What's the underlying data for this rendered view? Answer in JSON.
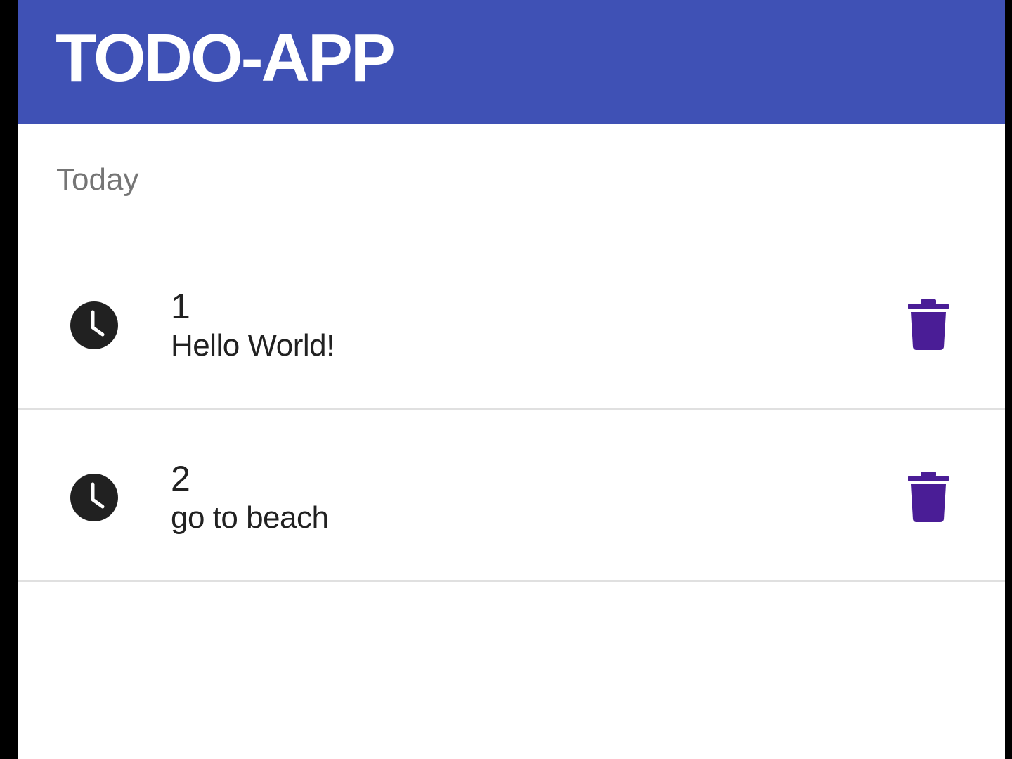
{
  "app": {
    "title": "TODO-APP",
    "header_color": "#3f51b5"
  },
  "list": {
    "subheader": "Today",
    "items": [
      {
        "id": "1",
        "text": "Hello World!",
        "icon": "clock-icon",
        "action_icon": "trash-icon"
      },
      {
        "id": "2",
        "text": "go to beach",
        "icon": "clock-icon",
        "action_icon": "trash-icon"
      }
    ]
  },
  "colors": {
    "accent": "#4a1d96",
    "icon": "#212121",
    "divider": "#e0e0e0",
    "subheader": "#757575"
  }
}
